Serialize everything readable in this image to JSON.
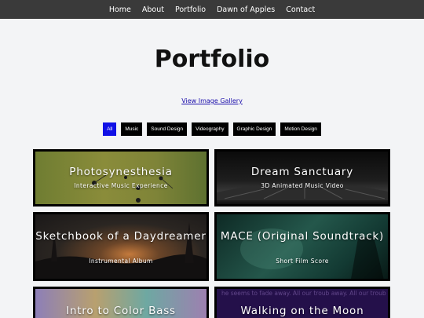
{
  "nav": {
    "items": [
      {
        "label": "Home"
      },
      {
        "label": "About"
      },
      {
        "label": "Portfolio"
      },
      {
        "label": "Dawn of Apples"
      },
      {
        "label": "Contact"
      }
    ]
  },
  "page": {
    "title": "Portfolio",
    "gallery_link": "View Image Gallery"
  },
  "filters": {
    "items": [
      {
        "label": "All",
        "active": true
      },
      {
        "label": "Music"
      },
      {
        "label": "Sound Design"
      },
      {
        "label": "Videography"
      },
      {
        "label": "Graphic Design"
      },
      {
        "label": "Motion Design"
      }
    ],
    "active_color": "#1010e6"
  },
  "cards": [
    {
      "title": "Photosynesthesia",
      "subtitle": "Interactive Music Experience"
    },
    {
      "title": "Dream Sanctuary",
      "subtitle": "3D Animated Music Video"
    },
    {
      "title": "Sketchbook of a Daydreamer",
      "subtitle": "Instrumental Album"
    },
    {
      "title": "MACE (Original Soundtrack)",
      "subtitle": "Short Film Score"
    },
    {
      "title": "Intro to Color Bass",
      "subtitle": ""
    },
    {
      "title": "Walking on the Moon",
      "subtitle": "",
      "background_text": "he seems to fade away. All our troub away. All our trouble seems to fade a"
    }
  ]
}
